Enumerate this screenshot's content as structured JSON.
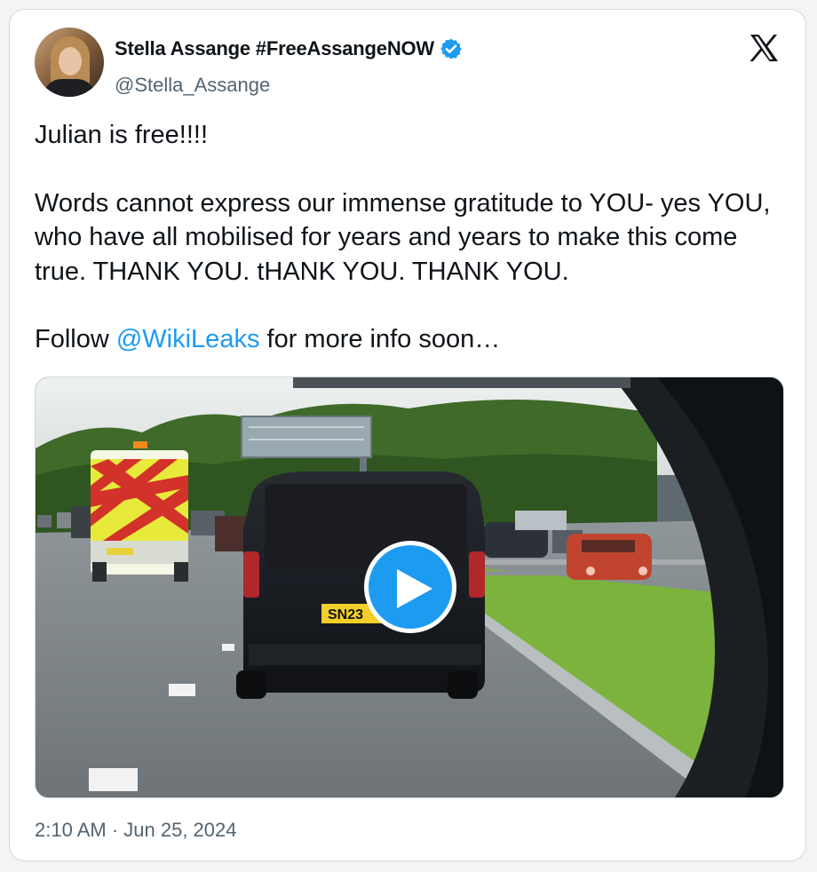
{
  "author": {
    "name": "Stella Assange #FreeAssangeNOW",
    "handle": "@Stella_Assange"
  },
  "tweet": {
    "line1": "Julian is free!!!!",
    "line2": "Words cannot express our immense gratitude to YOU- yes YOU, who have all mobilised for years and years to make this come true. THANK YOU. tHANK YOU. THANK YOU.",
    "line3_prefix": "Follow ",
    "line3_mention": "@WikiLeaks",
    "line3_suffix": " for more info soon…"
  },
  "media": {
    "plate_text": "SN23"
  },
  "timestamp": "2:10 AM · Jun 25, 2024",
  "icons": {
    "verified": "verified-badge-icon",
    "brand": "x-logo-icon",
    "play": "play-icon"
  },
  "colors": {
    "accent": "#1d9bf0",
    "text": "#0f1419",
    "muted": "#536471"
  }
}
